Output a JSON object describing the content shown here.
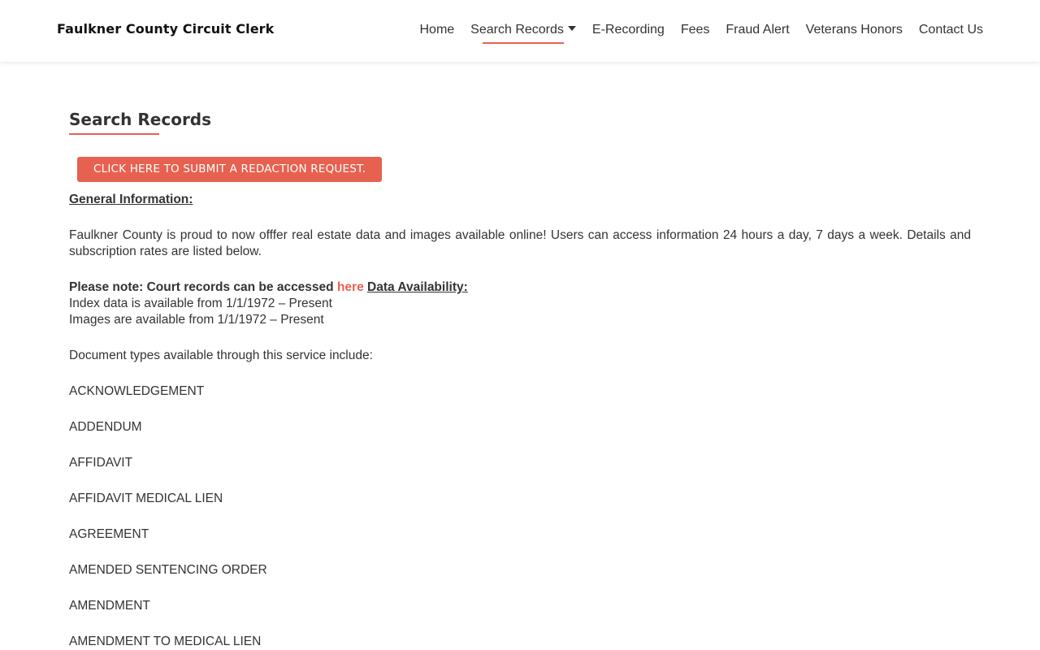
{
  "header": {
    "site_title": "Faulkner County Circuit Clerk",
    "nav": [
      {
        "label": "Home"
      },
      {
        "label": "Search Records"
      },
      {
        "label": "E-Recording"
      },
      {
        "label": "Fees"
      },
      {
        "label": "Fraud Alert"
      },
      {
        "label": "Veterans Honors"
      },
      {
        "label": "Contact Us"
      }
    ]
  },
  "main": {
    "title": "Search Records",
    "redaction_button": "CLICK HERE TO SUBMIT A REDACTION REQUEST.",
    "general_heading": "General Information:",
    "intro": "Faulkner County is proud to now offfer real estate data and images available online!  Users can access information 24 hours a day, 7 days a week. Details and subscription rates are listed below.",
    "note_prefix": "Please note:  Court records can be accessed ",
    "note_link": "here",
    "availability_heading": "Data Availability:",
    "index_availability": "Index data is available from 1/1/1972 – Present",
    "images_availability": "Images are available from 1/1/1972 – Present",
    "doc_types_intro": "Document types available through this service include:",
    "doc_types": [
      "ACKNOWLEDGEMENT",
      "ADDENDUM",
      "AFFIDAVIT",
      "AFFIDAVIT MEDICAL LIEN",
      "AGREEMENT",
      "AMENDED SENTENCING ORDER",
      "AMENDMENT",
      "AMENDMENT TO MEDICAL LIEN"
    ]
  },
  "colors": {
    "accent": "#e76150",
    "text": "#333333"
  },
  "icons": {
    "nav_dropdown": "caret-down-icon"
  }
}
